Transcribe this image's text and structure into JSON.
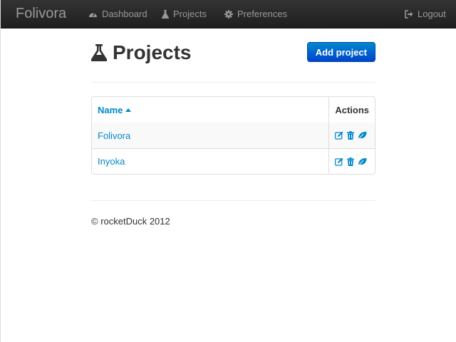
{
  "app": {
    "brand": "Folivora"
  },
  "nav": {
    "dashboard": "Dashboard",
    "projects": "Projects",
    "preferences": "Preferences",
    "logout": "Logout"
  },
  "page": {
    "title": "Projects",
    "add_button": "Add project"
  },
  "table": {
    "headers": {
      "name": "Name",
      "actions": "Actions"
    },
    "sort": "ascending",
    "rows": [
      {
        "name": "Folivora"
      },
      {
        "name": "Inyoka"
      }
    ]
  },
  "footer": {
    "text": "© rocketDuck 2012"
  },
  "colors": {
    "navbar": "#222222",
    "link": "#0088cc",
    "primary": "#0055cc"
  },
  "icons": [
    "dashboard-icon",
    "flask-icon",
    "gear-icon",
    "logout-icon",
    "edit-icon",
    "trash-icon",
    "leaf-icon",
    "sort-up-icon"
  ]
}
